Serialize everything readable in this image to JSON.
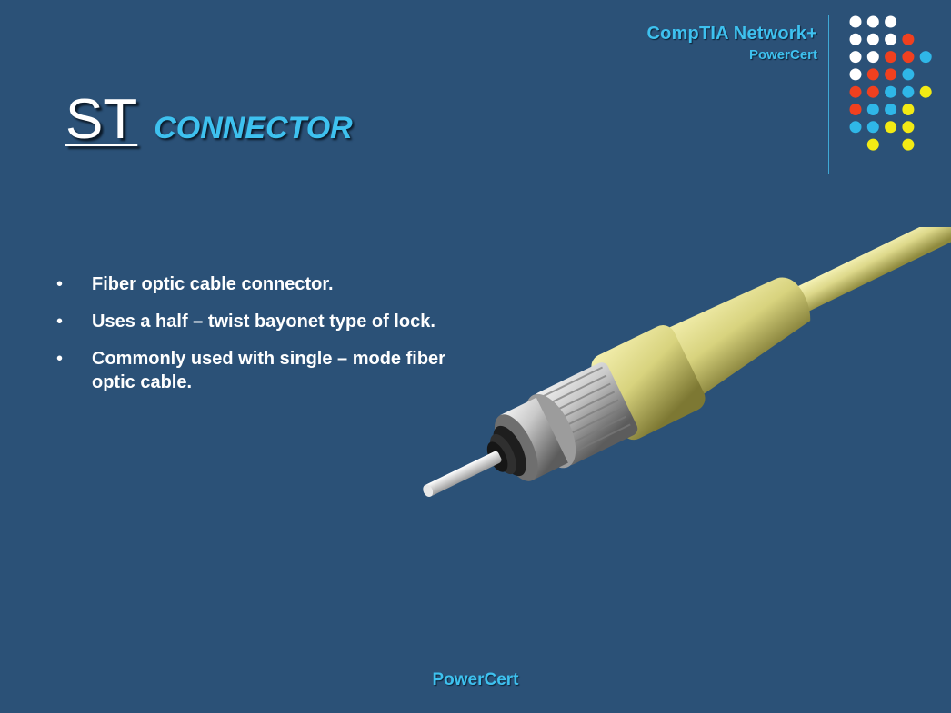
{
  "header": {
    "brand_line1": "CompTIA Network+",
    "brand_line2": "PowerCert"
  },
  "title": {
    "main": "ST",
    "sub": "CONNECTOR"
  },
  "bullets": [
    "Fiber optic cable connector.",
    "Uses a half – twist bayonet type of lock.",
    "Commonly used with single – mode fiber optic cable."
  ],
  "footer": {
    "brand": "PowerCert"
  },
  "colors": {
    "background": "#2b5177",
    "accent_blue": "#3ec1ef",
    "dot_white": "#ffffff",
    "dot_red": "#f0401f",
    "dot_blue": "#2fb7e8",
    "dot_yellow": "#f2ea14"
  },
  "decoration": {
    "dot_grid": [
      [
        "white",
        "white",
        "white",
        null,
        null
      ],
      [
        "white",
        "white",
        "white",
        "red",
        null
      ],
      [
        "white",
        "white",
        "red",
        "red",
        "blue"
      ],
      [
        "white",
        "red",
        "red",
        "blue",
        null
      ],
      [
        "red",
        "red",
        "blue",
        "blue",
        "yellow"
      ],
      [
        "red",
        "blue",
        "blue",
        "yellow",
        null
      ],
      [
        "blue",
        "blue",
        "yellow",
        "yellow",
        null
      ],
      [
        null,
        "yellow",
        null,
        "yellow",
        null
      ]
    ]
  },
  "image": {
    "name": "st-fiber-connector-illustration"
  }
}
